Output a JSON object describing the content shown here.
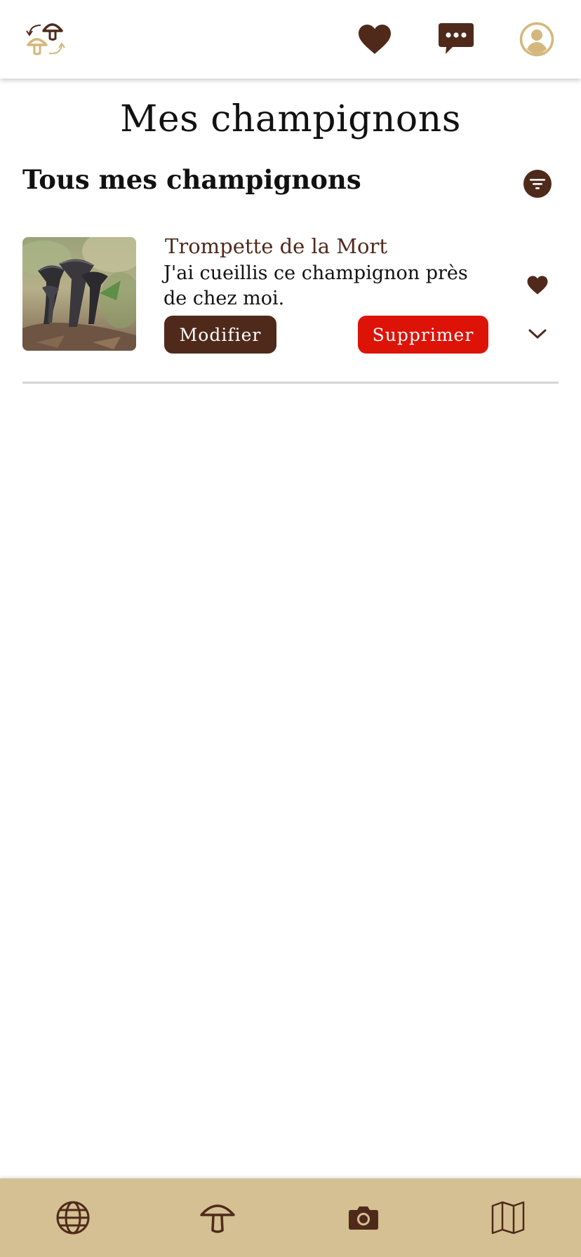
{
  "header": {
    "logo": "mushroom-swap-logo",
    "icons": [
      "heart-icon",
      "chat-bubble-icon",
      "user-circle-icon"
    ]
  },
  "page": {
    "title": "Mes champignons",
    "section_title": "Tous mes champignons"
  },
  "mushrooms": [
    {
      "name": "Trompette de la Mort",
      "description": "J'ai cueillis ce champignon près de chez moi.",
      "edit_label": "Modifier",
      "delete_label": "Supprimer"
    }
  ],
  "bottom_nav": {
    "items": [
      "globe-icon",
      "mushroom-icon",
      "camera-icon",
      "map-icon"
    ]
  },
  "colors": {
    "brown": "#4f2a1b",
    "tan": "#d4c092",
    "red": "#dd1308",
    "gold": "#d4b77c"
  }
}
